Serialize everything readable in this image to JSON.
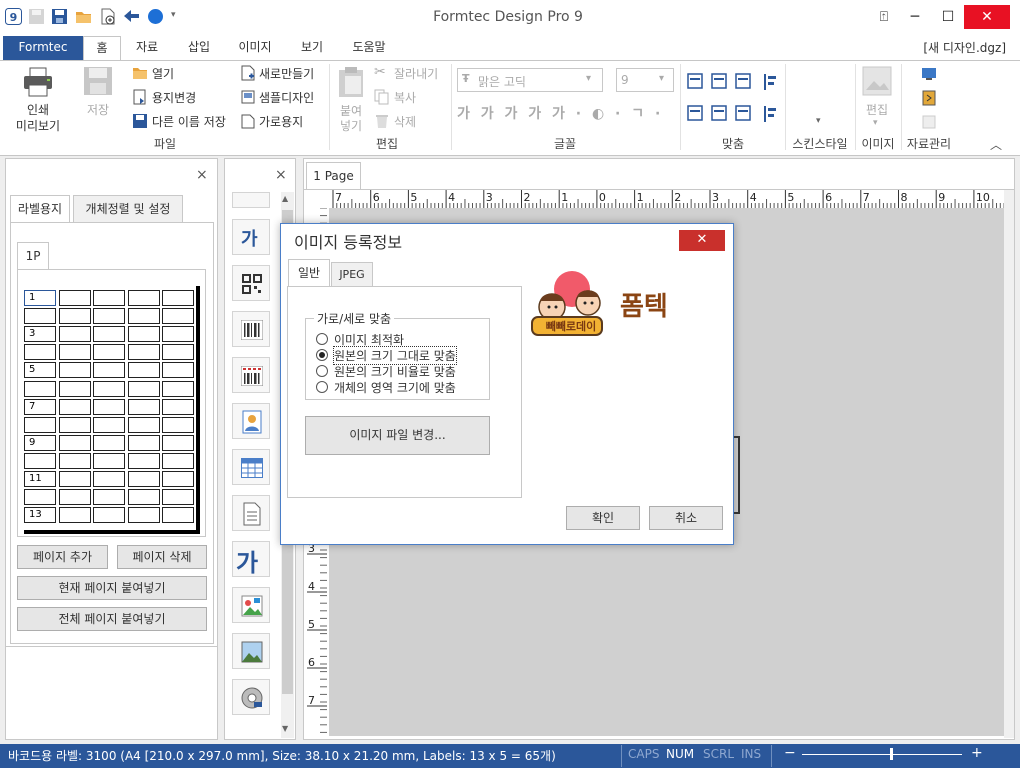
{
  "app": {
    "title": "Formtec Design Pro 9",
    "document": "[새 디자인.dgz]"
  },
  "window_controls": {
    "help": "⍐",
    "minimize": "─",
    "maximize": "☐",
    "close": "✕"
  },
  "ribbon_tabs": [
    "Formtec",
    "홈",
    "자료",
    "삽입",
    "이미지",
    "보기",
    "도움말"
  ],
  "ribbon": {
    "print_preview": "인쇄\n미리보기",
    "print_preview_l1": "인쇄",
    "print_preview_l2": "미리보기",
    "save": "저장",
    "open": "열기",
    "change_paper": "용지변경",
    "save_as": "다른 이름 저장",
    "new": "새로만들기",
    "sample_design": "샘플디자인",
    "landscape": "가로용지",
    "paste_l1": "붙여",
    "paste_l2": "넣기",
    "cut": "잘라내기",
    "copy": "복사",
    "delete": "삭제",
    "font_name": "맑은 고딕",
    "font_size": "9",
    "edit_image": "편집",
    "groups": {
      "file": "파일",
      "edit": "편집",
      "font": "글꼴",
      "align": "맞춤",
      "skin": "스킨스타일",
      "image": "이미지",
      "data": "자료관리"
    }
  },
  "left_panel": {
    "tabs": [
      "라벨용지",
      "개체정렬 및 설정"
    ],
    "page_tab": "1P",
    "row_labels": [
      "1",
      "",
      "3",
      "",
      "5",
      "",
      "7",
      "",
      "9",
      "",
      "11",
      "",
      "13"
    ],
    "buttons": {
      "add_page": "페이지 추가",
      "delete_page": "페이지 삭제",
      "paste_current": "현재 페이지 붙여넣기",
      "paste_all": "전체 페이지 붙여넣기"
    }
  },
  "canvas": {
    "page_tab": "1 Page",
    "ruler_top": [
      "7",
      "6",
      "5",
      "4",
      "3",
      "2",
      "1",
      "0",
      "1",
      "2",
      "3",
      "4",
      "5",
      "6",
      "7",
      "8",
      "9",
      "10"
    ],
    "ruler_left": [
      "3",
      "4",
      "5",
      "6",
      "7"
    ]
  },
  "dialog": {
    "title": "이미지 등록정보",
    "tabs": [
      "일반",
      "JPEG"
    ],
    "group_title": "가로/세로 맞춤",
    "options": [
      "이미지 최적화",
      "원본의 크기 그대로 맞춤",
      "원본의 크기 비율로 맞춤",
      "개체의 영역 크기에 맞춤"
    ],
    "selected_option": 1,
    "change_file_button": "이미지 파일 변경...",
    "ok": "확인",
    "cancel": "취소",
    "preview": {
      "logo_text": "폼텍",
      "badge_text": "빼빼로데이"
    }
  },
  "status": {
    "info": "바코드용 라벨: 3100 (A4 [210.0 x 297.0 mm], Size: 38.10 x 21.20 mm,  Labels: 13 x 5 = 65개)",
    "caps": "CAPS",
    "num": "NUM",
    "scrl": "SCRL",
    "ins": "INS",
    "zoom_minus": "−",
    "zoom_plus": "+",
    "zoom_level": 0.55
  },
  "colors": {
    "accent": "#2b579a",
    "close_red": "#e81123",
    "dialog_close": "#c9302c"
  }
}
